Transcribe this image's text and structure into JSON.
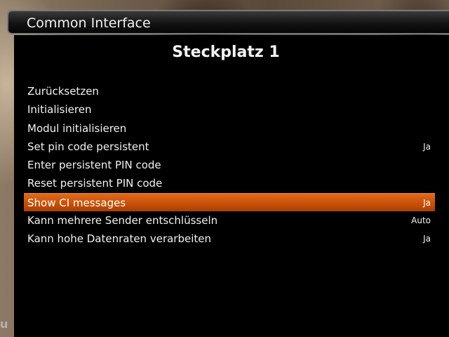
{
  "header": {
    "title": "Common Interface"
  },
  "page": {
    "title": "Steckplatz 1"
  },
  "background": {
    "edge_text": "u"
  },
  "colors": {
    "highlight": "#c85410",
    "panel": "#000000",
    "text": "#f2f2f2"
  },
  "menu": {
    "selected_index": 6,
    "items": [
      {
        "label": "Zurücksetzen",
        "value": ""
      },
      {
        "label": "Initialisieren",
        "value": ""
      },
      {
        "label": "Modul initialisieren",
        "value": ""
      },
      {
        "label": "Set pin code persistent",
        "value": "Ja"
      },
      {
        "label": "Enter persistent PIN code",
        "value": ""
      },
      {
        "label": "Reset persistent PIN code",
        "value": ""
      },
      {
        "label": "Show CI messages",
        "value": "Ja"
      },
      {
        "label": "Kann mehrere Sender entschlüsseln",
        "value": "Auto"
      },
      {
        "label": "Kann hohe Datenraten verarbeiten",
        "value": "Ja"
      }
    ]
  }
}
